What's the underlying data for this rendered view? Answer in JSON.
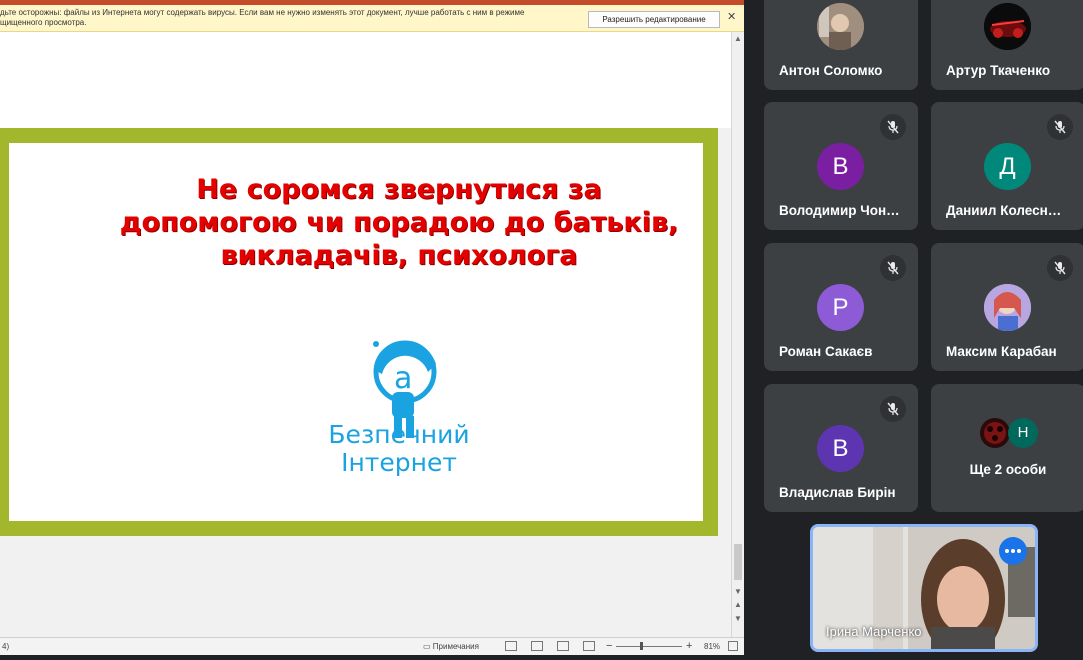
{
  "document": {
    "infobar": {
      "text_line1": "дьте осторожны: файлы из Интернета могут содержать вирусы. Если вам не нужно изменять этот документ, лучше работать с ним в режиме",
      "text_line2": "щищенного просмотра.",
      "enable_editing_label": "Разрешить редактирование",
      "close_glyph": "✕"
    },
    "slide": {
      "title_lines": [
        "Не соромся звернутися за",
        "допомогою чи порадою до батьків,",
        "викладачів, психолога"
      ],
      "logo_line1": "Безпечний",
      "logo_line2": "Інтернет",
      "colors": {
        "frame": "#a2b72b",
        "title": "#e50000",
        "logo": "#1aa3e0"
      }
    },
    "statusbar": {
      "left_text": "4)",
      "notes_label": "Примечания",
      "zoom_minus": "−",
      "zoom_plus": "+",
      "zoom_level": "81%"
    }
  },
  "meet": {
    "participants": [
      {
        "name": "Антон Соломко",
        "avatar_type": "photo",
        "muted": false
      },
      {
        "name": "Артур Ткаченко",
        "avatar_type": "photo",
        "muted": false
      },
      {
        "name": "Володимир Чон…",
        "initial": "В",
        "avatar_color": "#7b1fa2",
        "muted": true
      },
      {
        "name": "Даниил Колесн…",
        "initial": "Д",
        "avatar_color": "#00897b",
        "muted": true
      },
      {
        "name": "Роман Сакаєв",
        "initial": "Р",
        "avatar_color": "#8e5bd6",
        "muted": true
      },
      {
        "name": "Максим Карабан",
        "avatar_type": "photo",
        "muted": true
      },
      {
        "name": "Владислав Бирін",
        "initial": "В",
        "avatar_color": "#5e35b1",
        "muted": true
      },
      {
        "name": "Ще 2 особи",
        "initial": "Н",
        "avatar_color": "#00695c",
        "muted": false
      }
    ],
    "self": {
      "name": "Ірина Марченко",
      "more_icon": "more-dots-icon"
    },
    "mic_off_icon": "mic-off-icon"
  }
}
